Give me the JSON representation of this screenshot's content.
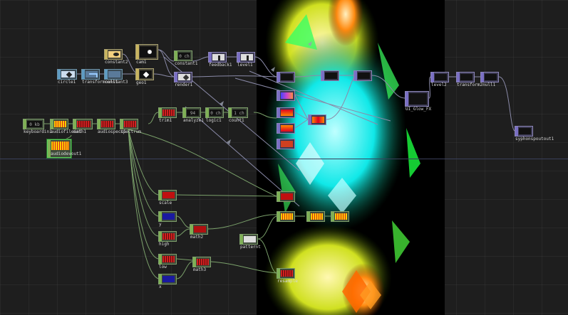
{
  "nodes": {
    "constant2": "constant2",
    "cam1": "cam1",
    "constant1": "constant1",
    "constant1_info": "0 ch",
    "feedback1": "feedback1",
    "level1": "level1",
    "circle1": "circle1",
    "transform_null1": "transformnull1",
    "constant3": "constant3",
    "geo1": "geo1",
    "render1": "render1",
    "keyboardin1": "keyboardin1",
    "keyboardin1_info": "0 kb",
    "audiofilein1": "audiofilein1",
    "math1": "math1",
    "audiospect1": "audiospect1",
    "spectrum": "spectrum",
    "trim1": "trim1",
    "analyze1": "analyze1",
    "analyze1_info": "94 ch",
    "logic1": "logic1",
    "logic1_info": "0 ch",
    "count1": "count1",
    "count1_info": "1 ch",
    "audiodevout1": "audiodevout1",
    "scale": "scale",
    "y": "y",
    "high": "high",
    "math2": "math2",
    "patternt": "patternt",
    "low": "low",
    "x": "x",
    "math3": "math3",
    "resample": "resample",
    "level2": "level2",
    "transform2null1": "transform2null1",
    "ulglowfx": "UI_Glow_FX",
    "syphonspoutout1": "syphonspoutout1"
  }
}
